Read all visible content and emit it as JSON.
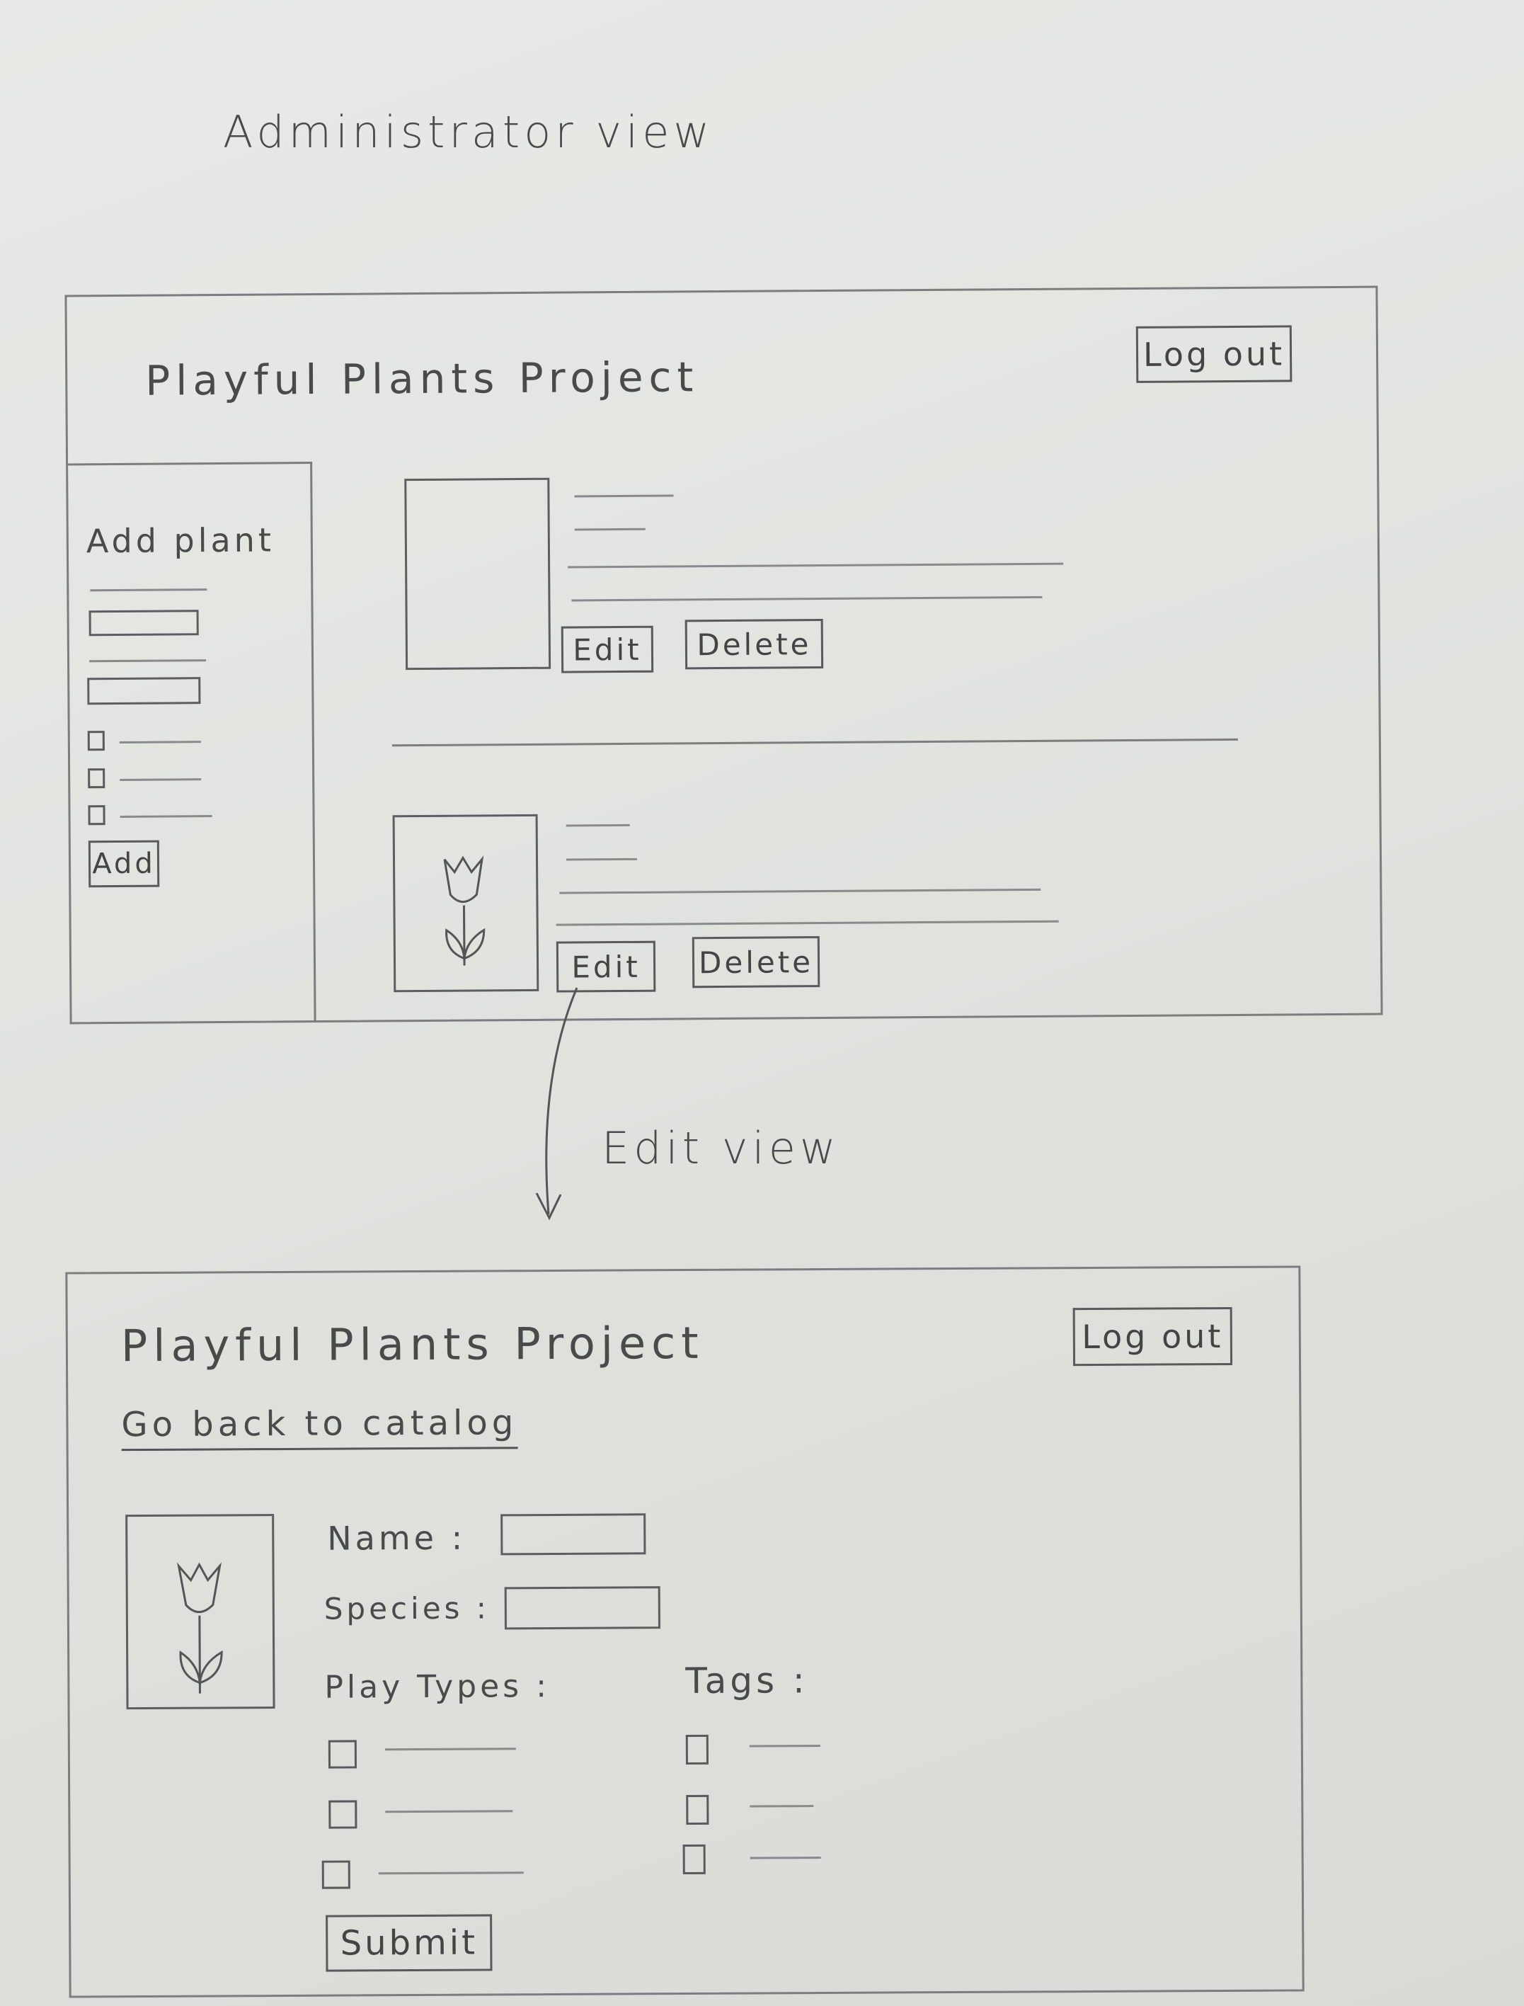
{
  "admin_heading": "Administrator view",
  "edit_heading": "Edit view",
  "admin": {
    "brand": "Playful Plants Project",
    "logout_label": "Log out",
    "sidebar": {
      "title": "Add plant",
      "add_label": "Add"
    },
    "plants": [
      {
        "edit_label": "Edit",
        "delete_label": "Delete",
        "image": "blank"
      },
      {
        "edit_label": "Edit",
        "delete_label": "Delete",
        "image": "tulip-icon"
      }
    ]
  },
  "edit": {
    "brand": "Playful Plants Project",
    "logout_label": "Log out",
    "back_link": "Go back to catalog",
    "name_label": "Name :",
    "species_label": "Species :",
    "play_types_label": "Play Types :",
    "tags_label": "Tags :",
    "submit_label": "Submit",
    "image": "tulip-icon"
  }
}
